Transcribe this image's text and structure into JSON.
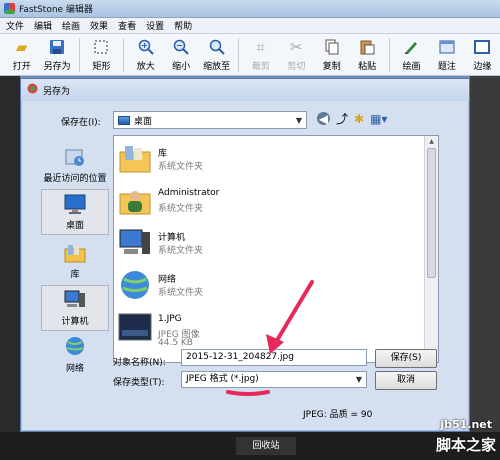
{
  "app": {
    "title": "FastStone 编辑器"
  },
  "menu": [
    "文件",
    "编辑",
    "绘画",
    "效果",
    "查看",
    "设置",
    "帮助"
  ],
  "toolbar": [
    {
      "label": "打开",
      "icon": "open-folder-icon",
      "enabled": true
    },
    {
      "label": "另存为",
      "icon": "save-disk-icon",
      "enabled": true
    },
    {
      "label": "矩形",
      "icon": "rect-select-icon",
      "enabled": true
    },
    {
      "label": "放大",
      "icon": "zoom-in-icon",
      "enabled": true
    },
    {
      "label": "缩小",
      "icon": "zoom-out-icon",
      "enabled": true
    },
    {
      "label": "缩放至",
      "icon": "zoom-to-icon",
      "enabled": true
    },
    {
      "label": "裁剪",
      "icon": "crop-icon",
      "enabled": false
    },
    {
      "label": "剪切",
      "icon": "cut-icon",
      "enabled": false
    },
    {
      "label": "复制",
      "icon": "copy-icon",
      "enabled": true
    },
    {
      "label": "粘贴",
      "icon": "paste-icon",
      "enabled": true
    },
    {
      "label": "绘画",
      "icon": "draw-icon",
      "enabled": true
    },
    {
      "label": "题注",
      "icon": "caption-icon",
      "enabled": true
    },
    {
      "label": "边缘",
      "icon": "edge-icon",
      "enabled": true
    }
  ],
  "dialog": {
    "title": "另存为",
    "save_in_label": "保存在(I):",
    "save_in_value": "桌面",
    "places": [
      {
        "label": "最近访问的位置",
        "icon": "recent-places-icon",
        "selected": false
      },
      {
        "label": "桌面",
        "icon": "desktop-icon",
        "selected": true
      },
      {
        "label": "库",
        "icon": "library-icon",
        "selected": false
      },
      {
        "label": "计算机",
        "icon": "computer-icon",
        "selected": false
      },
      {
        "label": "网络",
        "icon": "network-icon",
        "selected": false
      }
    ],
    "files": [
      {
        "name": "库",
        "type": "系统文件夹",
        "icon": "library-folder-icon"
      },
      {
        "name": "Administrator",
        "type": "系统文件夹",
        "icon": "user-folder-icon"
      },
      {
        "name": "计算机",
        "type": "系统文件夹",
        "icon": "computer-icon"
      },
      {
        "name": "网络",
        "type": "系统文件夹",
        "icon": "network-icon"
      },
      {
        "name": "1.JPG",
        "type": "JPEG 图像",
        "size": "44.5 KB",
        "icon": "jpg-thumbnail-icon"
      }
    ],
    "filename_label": "对象名称(N):",
    "filename_value": "2015-12-31_204827.jpg",
    "filetype_label": "保存类型(T):",
    "filetype_value": "JPEG 格式 (*.jpg)",
    "save_button": "保存(S)",
    "cancel_button": "取消",
    "quality": "JPEG: 品质 = 90"
  },
  "desktop": {
    "recycle_bin": "回收站"
  },
  "watermark": {
    "url": "jb51.net",
    "name": "脚本之家"
  },
  "colors": {
    "annotation": "#e8285a",
    "dialog_bg": "#d4dff0",
    "title_bar": "#c3d4ec"
  }
}
